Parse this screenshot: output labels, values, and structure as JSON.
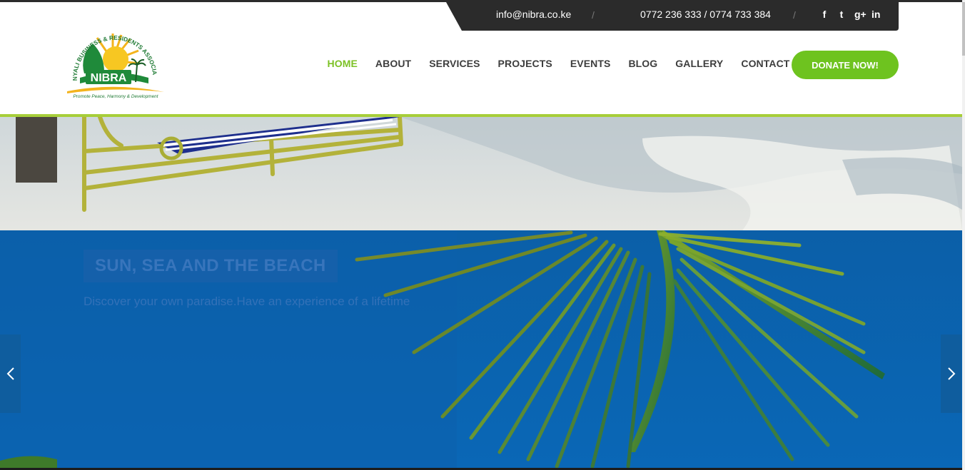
{
  "topbar": {
    "email": "info@nibra.co.ke",
    "separator": "/",
    "phone": "0772 236 333 / 0774 733 384",
    "social": [
      {
        "name": "facebook-icon",
        "glyph": "f"
      },
      {
        "name": "twitter-icon",
        "glyph": "t"
      },
      {
        "name": "google-plus-icon",
        "glyph": "g+"
      },
      {
        "name": "linkedin-icon",
        "glyph": "in"
      }
    ]
  },
  "logo": {
    "name": "NIBRA",
    "arc_text": "NYALI BUSINESS & RESIDENTS ASSOCIATION",
    "tagline": "Promote Peace, Harmony & Development"
  },
  "nav": {
    "items": [
      {
        "label": "HOME",
        "active": true
      },
      {
        "label": "ABOUT",
        "active": false
      },
      {
        "label": "SERVICES",
        "active": false
      },
      {
        "label": "PROJECTS",
        "active": false
      },
      {
        "label": "EVENTS",
        "active": false
      },
      {
        "label": "BLOG",
        "active": false
      },
      {
        "label": "GALLERY",
        "active": false
      },
      {
        "label": "CONTACT US",
        "active": false
      }
    ],
    "donate_label": "DONATE NOW!"
  },
  "slider": {
    "title": "SUN, SEA AND THE BEACH",
    "subtitle": "Discover your own paradise.Have an experience of a lifetime"
  },
  "colors": {
    "accent_green": "#6ec31f",
    "nav_active": "#7cc125",
    "topbar_bg": "#2b2b2b",
    "sky_blue": "#0b63b0"
  }
}
